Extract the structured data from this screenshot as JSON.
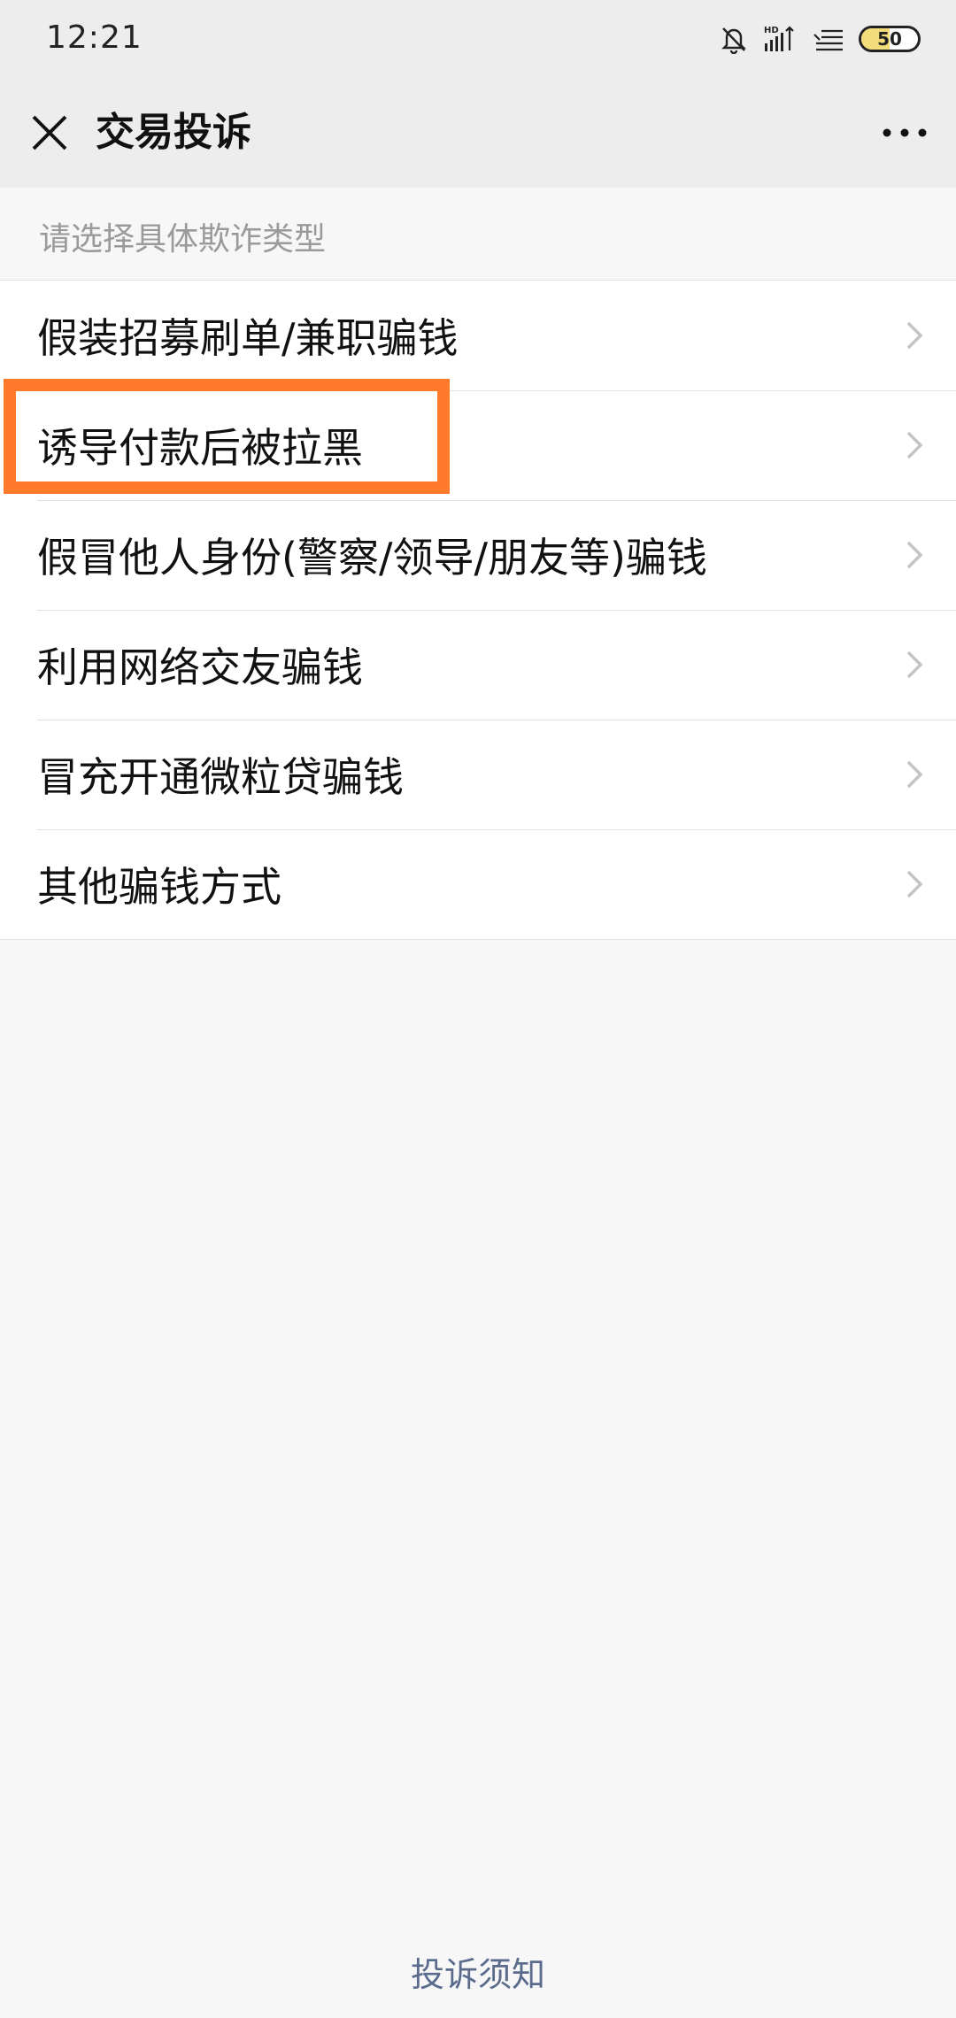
{
  "status_bar": {
    "time": "12:21",
    "icons": [
      "mute-bell-icon",
      "hd-signal-icon",
      "wifi-icon"
    ],
    "battery_level": "50",
    "battery_fraction": 0.5
  },
  "nav": {
    "title": "交易投诉",
    "close_icon": "close-icon",
    "more_icon": "more-icon"
  },
  "section": {
    "header": "请选择具体欺诈类型"
  },
  "list": {
    "items": [
      {
        "label": "假装招募刷单/兼职骗钱"
      },
      {
        "label": "诱导付款后被拉黑"
      },
      {
        "label": "假冒他人身份(警察/领导/朋友等)骗钱"
      },
      {
        "label": "利用网络交友骗钱"
      },
      {
        "label": "冒充开通微粒贷骗钱"
      },
      {
        "label": "其他骗钱方式"
      }
    ],
    "highlighted_index": 1
  },
  "footer": {
    "link": "投诉须知"
  },
  "colors": {
    "highlight": "#ff7a2a",
    "link": "#5a6b8c",
    "header_text": "#9a9a9a"
  }
}
